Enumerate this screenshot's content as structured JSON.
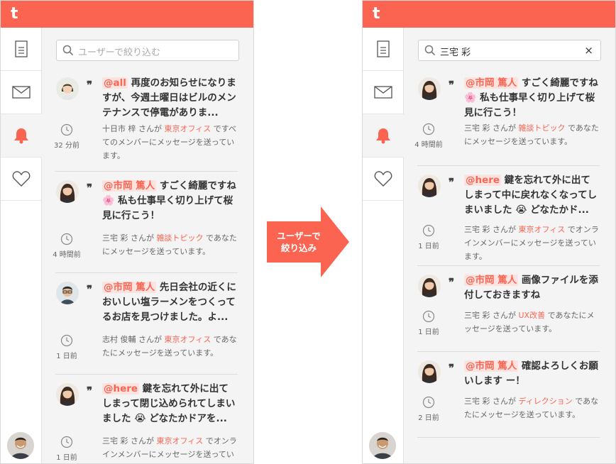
{
  "app": {
    "logo": "t"
  },
  "arrow": {
    "line1": "ユーザーで",
    "line2": "絞り込み"
  },
  "left_panel": {
    "search": {
      "placeholder": "ユーザーで絞り込む",
      "value": ""
    },
    "notifications": [
      {
        "mention": "@all",
        "text": " 再度のお知らせになりますが、今週土曜日はビルのメンテナンスで停電がありま...",
        "emoji": "",
        "time": "32 分前",
        "sender": "十日市 梓",
        "room": "東京オフィス",
        "meta_mid": " さんが ",
        "meta_tail": " ですべてのメンバーにメッセージを送っています。",
        "avatar": "woman-short"
      },
      {
        "mention": "@市岡 篤人",
        "text": " すごく綺麗ですね ",
        "emoji": "🌸",
        "text2": " 私も仕事早く切り上げて桜見に行こう！",
        "time": "4 時間前",
        "sender": "三宅 彩",
        "room": "雑談トピック",
        "meta_mid": " さんが ",
        "meta_tail": " であなたにメッセージを送っています。",
        "avatar": "woman-long"
      },
      {
        "mention": "@市岡 篤人",
        "text": " 先日会社の近くにおいしい塩ラーメンをつくってるお店を見つけました。よ...",
        "emoji": "",
        "time": "1 日前",
        "sender": "志村 俊輔",
        "room": "東京オフィス",
        "meta_mid": " さんが ",
        "meta_tail": " であなたにメッセージを送っています。",
        "avatar": "man-glasses"
      },
      {
        "mention": "@here",
        "text": " 鍵を忘れて外に出てしまって閉じ込められてしまいました ",
        "emoji": "😭",
        "text2": " どなたかドアを...",
        "time": "1 日前",
        "sender": "三宅 彩",
        "room": "東京オフィス",
        "meta_mid": " さんが ",
        "meta_tail": " でオンラインメンバーにメッセージを送っています。",
        "avatar": "woman-long"
      }
    ]
  },
  "right_panel": {
    "search": {
      "placeholder": "",
      "value": "三宅 彩",
      "clear": "×"
    },
    "notifications": [
      {
        "mention": "@市岡 篤人",
        "text": " すごく綺麗ですね ",
        "emoji": "🌸",
        "text2": " 私も仕事早く切り上げて桜見に行こう！",
        "time": "4 時間前",
        "sender": "三宅 彩",
        "room": "雑談トピック",
        "meta_mid": " さんが ",
        "meta_tail": " であなたにメッセージを送っています。",
        "avatar": "woman-long"
      },
      {
        "mention": "@here",
        "text": " 鍵を忘れて外に出てしまって中に戻れなくなってしまいました ",
        "emoji": "😭",
        "text2": " どなたかド...",
        "time": "1 日前",
        "sender": "三宅 彩",
        "room": "東京オフィス",
        "meta_mid": " さんが ",
        "meta_tail": " でオンラインメンバーにメッセージを送っています。",
        "avatar": "woman-long"
      },
      {
        "mention": "@市岡 篤人",
        "text": " 画像ファイルを添付しておきますね",
        "emoji": "",
        "time": "1 日前",
        "sender": "三宅 彩",
        "room": "UX改善",
        "meta_mid": " さんが ",
        "meta_tail": " であなたにメッセージを送っています。",
        "avatar": "woman-long"
      },
      {
        "mention": "@市岡 篤人",
        "text": " 確認よろしくお願いします ー！",
        "emoji": "",
        "time": "2 日前",
        "sender": "三宅 彩",
        "room": "ディレクション",
        "meta_mid": " さんが ",
        "meta_tail": " であなたにメッセージを送っています。",
        "avatar": "woman-long"
      }
    ]
  },
  "colors": {
    "accent": "#fc6452",
    "mention_bg": "#fde3df",
    "panel_bg": "#f4f4f4"
  }
}
